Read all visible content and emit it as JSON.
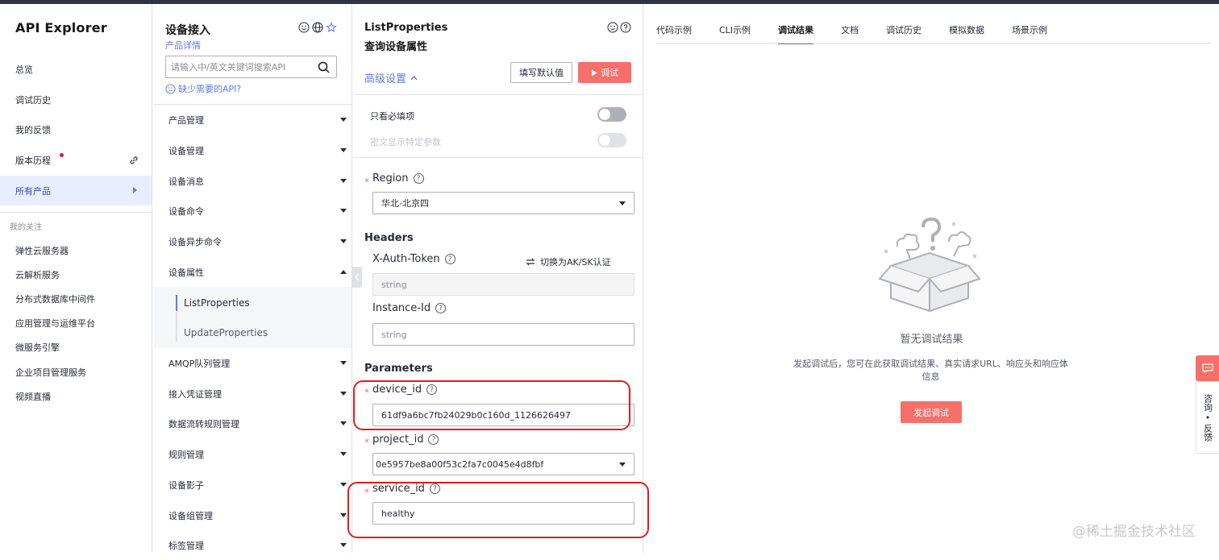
{
  "app": {
    "title": "API Explorer"
  },
  "nav": [
    {
      "label": "总览"
    },
    {
      "label": "调试历史"
    },
    {
      "label": "我的反馈"
    },
    {
      "label": "版本历程"
    },
    {
      "label": "所有产品"
    }
  ],
  "favorites": {
    "title": "我的关注",
    "items": [
      "弹性云服务器",
      "云解析服务",
      "分布式数据库中间件",
      "应用管理与运维平台",
      "微服务引擎",
      "企业项目管理服务",
      "视频直播"
    ]
  },
  "service": {
    "title": "设备接入",
    "detail_link": "产品详情",
    "search_placeholder": "请输入中/英文关键词搜索API",
    "missing_api": "缺少需要的API?",
    "categories": [
      "产品管理",
      "设备管理",
      "设备消息",
      "设备命令",
      "设备异步命令",
      "设备属性",
      "AMQP队列管理",
      "接入凭证管理",
      "数据流转规则管理",
      "规则管理",
      "设备影子",
      "设备组管理",
      "标签管理"
    ],
    "sub_items": [
      "ListProperties",
      "UpdateProperties"
    ]
  },
  "api": {
    "name": "ListProperties",
    "cn_name": "查询设备属性",
    "advanced": "高级设置",
    "fill_default": "填写默认值",
    "debug": "调试",
    "only_required": "只看必填项",
    "plaintext": "密文显示特定参数",
    "region_label": "Region",
    "region_value": "华北-北京四",
    "headers_title": "Headers",
    "token_label": "X-Auth-Token",
    "switch_auth": "切换为AK/SK认证",
    "token_placeholder": "string",
    "instance_label": "Instance-Id",
    "instance_placeholder": "string",
    "params_title": "Parameters",
    "device_id_label": "device_id",
    "device_id_value": "61df9a6bc7fb24029b0c160d_1126626497",
    "project_id_label": "project_id",
    "project_id_value": "0e5957be8a00f53c2fa7c0045e4d8fbf",
    "service_id_label": "service_id",
    "service_id_value": "healthy"
  },
  "result": {
    "tabs": [
      "代码示例",
      "CLI示例",
      "调试结果",
      "文档",
      "调试历史",
      "模拟数据",
      "场景示例"
    ],
    "empty_title": "暂无调试结果",
    "empty_desc": "发起调试后，您可在此获取调试结果、真实请求URL、响应头和响应体信息",
    "start_button": "发起调试"
  },
  "floating": {
    "consult": "咨询",
    "dot": "•",
    "feedback": "反馈"
  },
  "watermark": "@稀土掘金技术社区",
  "colors": {
    "accent": "#5e7ce0",
    "primary_button": "#f66f6a",
    "highlight": "#e21c1c"
  }
}
